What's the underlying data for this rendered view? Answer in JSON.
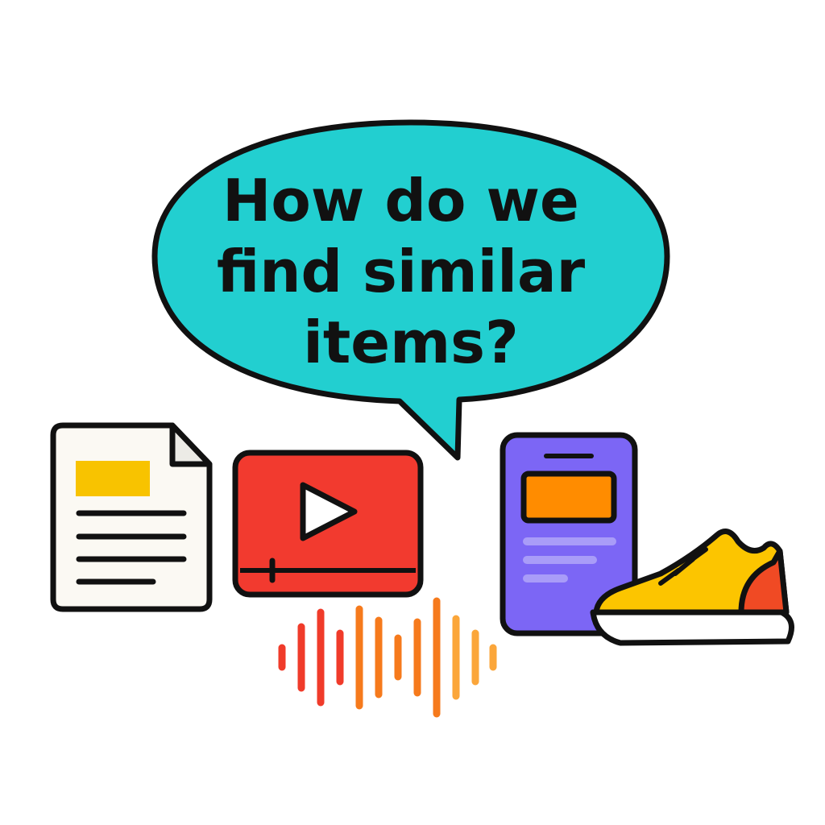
{
  "bubble": {
    "lines": [
      "How do we",
      "find similar",
      "items?"
    ]
  },
  "icons": {
    "document": "document-icon",
    "video": "video-player-icon",
    "play": "play-icon",
    "audio": "audio-waveform-icon",
    "phone": "smartphone-icon",
    "shoe": "sneaker-icon"
  },
  "colors": {
    "background": "#ffffff",
    "outline": "#111111",
    "bubble": "#22cfd0",
    "document_paper": "#fbf9f3",
    "document_fold": "#ecebe6",
    "document_highlight": "#f8c300",
    "video": "#f23a2f",
    "video_play": "#ffffff",
    "phone": "#7c66f5",
    "phone_card": "#ff8c00",
    "phone_lines": "#a99cf8",
    "shoe_upper": "#fcc500",
    "shoe_heel": "#f04a24",
    "shoe_sole": "#ffffff",
    "wave_red": "#f03b2a",
    "wave_orange": "#f67a1c",
    "wave_amber": "#fba63a"
  }
}
